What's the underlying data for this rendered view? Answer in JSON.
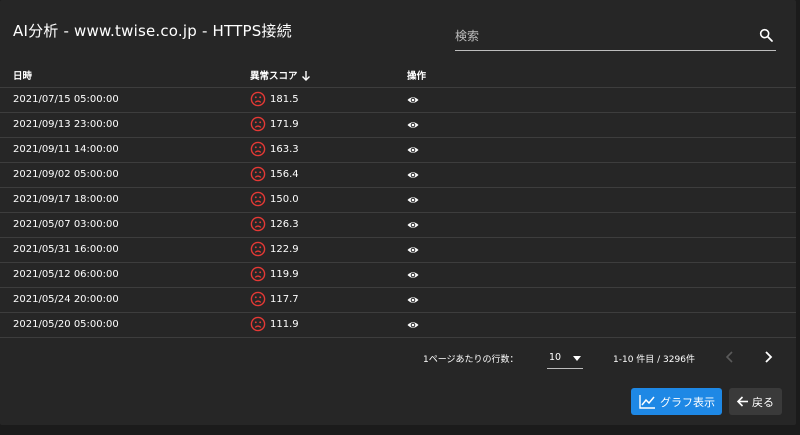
{
  "dialog": {
    "title": "AI分析 - www.twise.co.jp - HTTPS接続"
  },
  "search": {
    "placeholder": "検索",
    "value": ""
  },
  "table": {
    "headers": {
      "datetime": "日時",
      "score": "異常スコア",
      "actions": "操作"
    },
    "sort": {
      "column": "score",
      "direction": "desc"
    },
    "rows": [
      {
        "datetime": "2021/07/15 05:00:00",
        "score": "181.5"
      },
      {
        "datetime": "2021/09/13 23:00:00",
        "score": "171.9"
      },
      {
        "datetime": "2021/09/11 14:00:00",
        "score": "163.3"
      },
      {
        "datetime": "2021/09/02 05:00:00",
        "score": "156.4"
      },
      {
        "datetime": "2021/09/17 18:00:00",
        "score": "150.0"
      },
      {
        "datetime": "2021/05/07 03:00:00",
        "score": "126.3"
      },
      {
        "datetime": "2021/05/31 16:00:00",
        "score": "122.9"
      },
      {
        "datetime": "2021/05/12 06:00:00",
        "score": "119.9"
      },
      {
        "datetime": "2021/05/24 20:00:00",
        "score": "117.7"
      },
      {
        "datetime": "2021/05/20 05:00:00",
        "score": "111.9"
      }
    ]
  },
  "pagination": {
    "rows_per_page_label": "1ページあたりの行数：",
    "rows_per_page": "10",
    "range": "1-10 件目 / 3296件"
  },
  "buttons": {
    "graph": "グラフ表示",
    "back": "戻る"
  },
  "colors": {
    "accent": "#1e88e5",
    "anomaly": "#e53935",
    "background": "#262626",
    "divider": "#3d3d3d"
  },
  "icons": {
    "search": "search-icon",
    "sort": "arrow-down-icon",
    "anomaly": "sad-face-icon",
    "view": "eye-icon",
    "prev": "chevron-left-icon",
    "next": "chevron-right-icon",
    "graph": "line-chart-icon",
    "back": "arrow-left-icon"
  }
}
